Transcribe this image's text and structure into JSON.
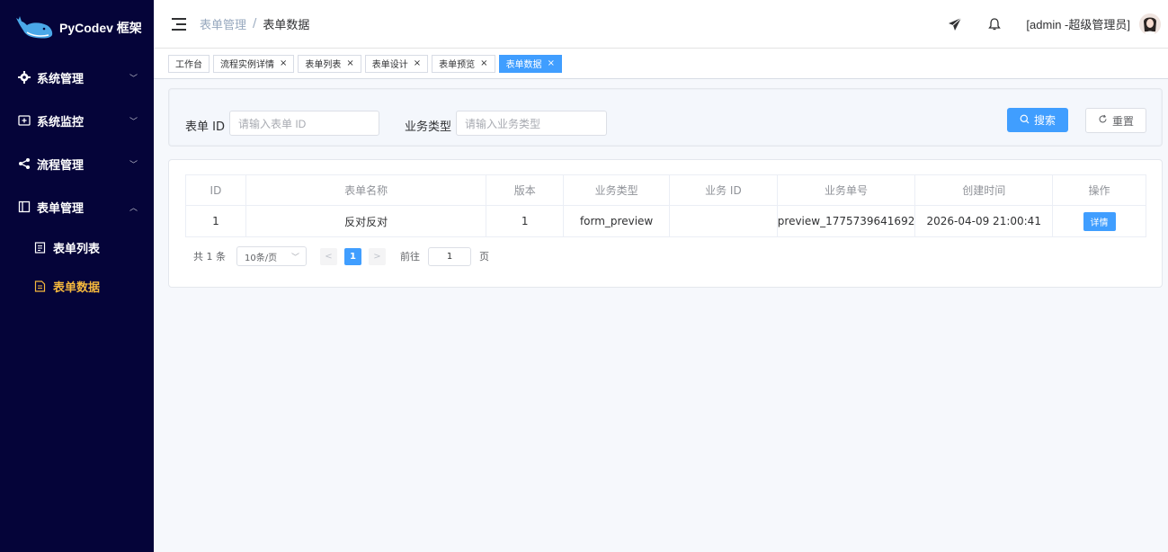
{
  "app": {
    "logo_text": "PyCodev 框架"
  },
  "sidebar": {
    "items": [
      {
        "label": "系统管理",
        "icon": "gear-icon"
      },
      {
        "label": "系统监控",
        "icon": "monitor-icon"
      },
      {
        "label": "流程管理",
        "icon": "share-icon"
      },
      {
        "label": "表单管理",
        "icon": "form-icon"
      }
    ],
    "sub_items": [
      {
        "label": "表单列表",
        "icon": "document-icon"
      },
      {
        "label": "表单数据",
        "icon": "document-icon"
      }
    ]
  },
  "header": {
    "breadcrumb": {
      "parent": "表单管理",
      "sep": "/",
      "current": "表单数据"
    },
    "user_label": "[admin -超级管理员]"
  },
  "tags": [
    {
      "label": "工作台",
      "closable": false
    },
    {
      "label": "流程实例详情",
      "closable": true
    },
    {
      "label": "表单列表",
      "closable": true
    },
    {
      "label": "表单设计",
      "closable": true
    },
    {
      "label": "表单预览",
      "closable": true
    },
    {
      "label": "表单数据",
      "closable": true,
      "active": true
    }
  ],
  "search": {
    "form_id_label": "表单 ID",
    "form_id_placeholder": "请输入表单 ID",
    "biz_type_label": "业务类型",
    "biz_type_placeholder": "请输入业务类型",
    "search_label": "搜索",
    "reset_label": "重置"
  },
  "table": {
    "columns": [
      "ID",
      "表单名称",
      "版本",
      "业务类型",
      "业务 ID",
      "业务单号",
      "创建时间",
      "操作"
    ],
    "rows": [
      {
        "id": "1",
        "name": "反对反对",
        "version": "1",
        "biz_type": "form_preview",
        "biz_id": "",
        "biz_no": "preview_1775739641692",
        "created": "2026-04-09 21:00:41",
        "action": "详情"
      }
    ]
  },
  "pager": {
    "total_text": "共 1 条",
    "page_size": "10条/页",
    "current_page": "1",
    "goto_label": "前往",
    "goto_value": "1",
    "page_suffix": "页"
  },
  "colors": {
    "sidebar_bg": "#050439",
    "accent": "#409eff",
    "active_menu": "#f5b83d"
  }
}
